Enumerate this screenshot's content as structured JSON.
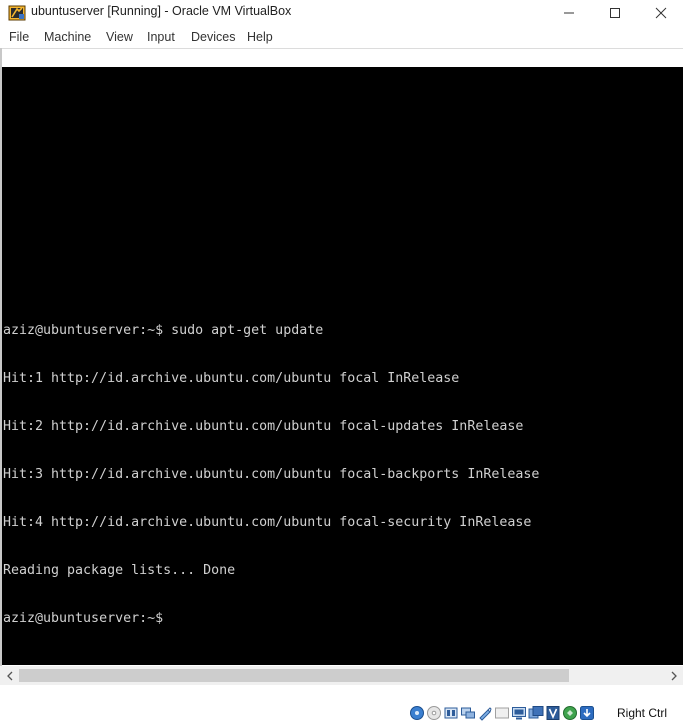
{
  "window": {
    "title": "ubuntuserver [Running] - Oracle VM VirtualBox"
  },
  "menu": {
    "items": [
      "File",
      "Machine",
      "View",
      "Input",
      "Devices",
      "Help"
    ]
  },
  "console": {
    "lines": [
      "aziz@ubuntuserver:~$ sudo apt-get update",
      "Hit:1 http://id.archive.ubuntu.com/ubuntu focal InRelease",
      "Hit:2 http://id.archive.ubuntu.com/ubuntu focal-updates InRelease",
      "Hit:3 http://id.archive.ubuntu.com/ubuntu focal-backports InRelease",
      "Hit:4 http://id.archive.ubuntu.com/ubuntu focal-security InRelease",
      "Reading package lists... Done",
      "aziz@ubuntuserver:~$"
    ]
  },
  "statusbar": {
    "icons": [
      "hard-disk-icon",
      "optical-drive-icon",
      "audio-icon",
      "network-icon",
      "usb-icon",
      "shared-folders-icon",
      "display-icon",
      "video-capture-icon",
      "virtualization-icon",
      "mouse-integration-icon",
      "keyboard-icon"
    ],
    "host_key": "Right Ctrl"
  },
  "colors": {
    "console_bg": "#000000",
    "console_fg": "#d0d0d0",
    "scroll_track": "#f0f0f0",
    "scroll_thumb": "#cdcdcd"
  }
}
